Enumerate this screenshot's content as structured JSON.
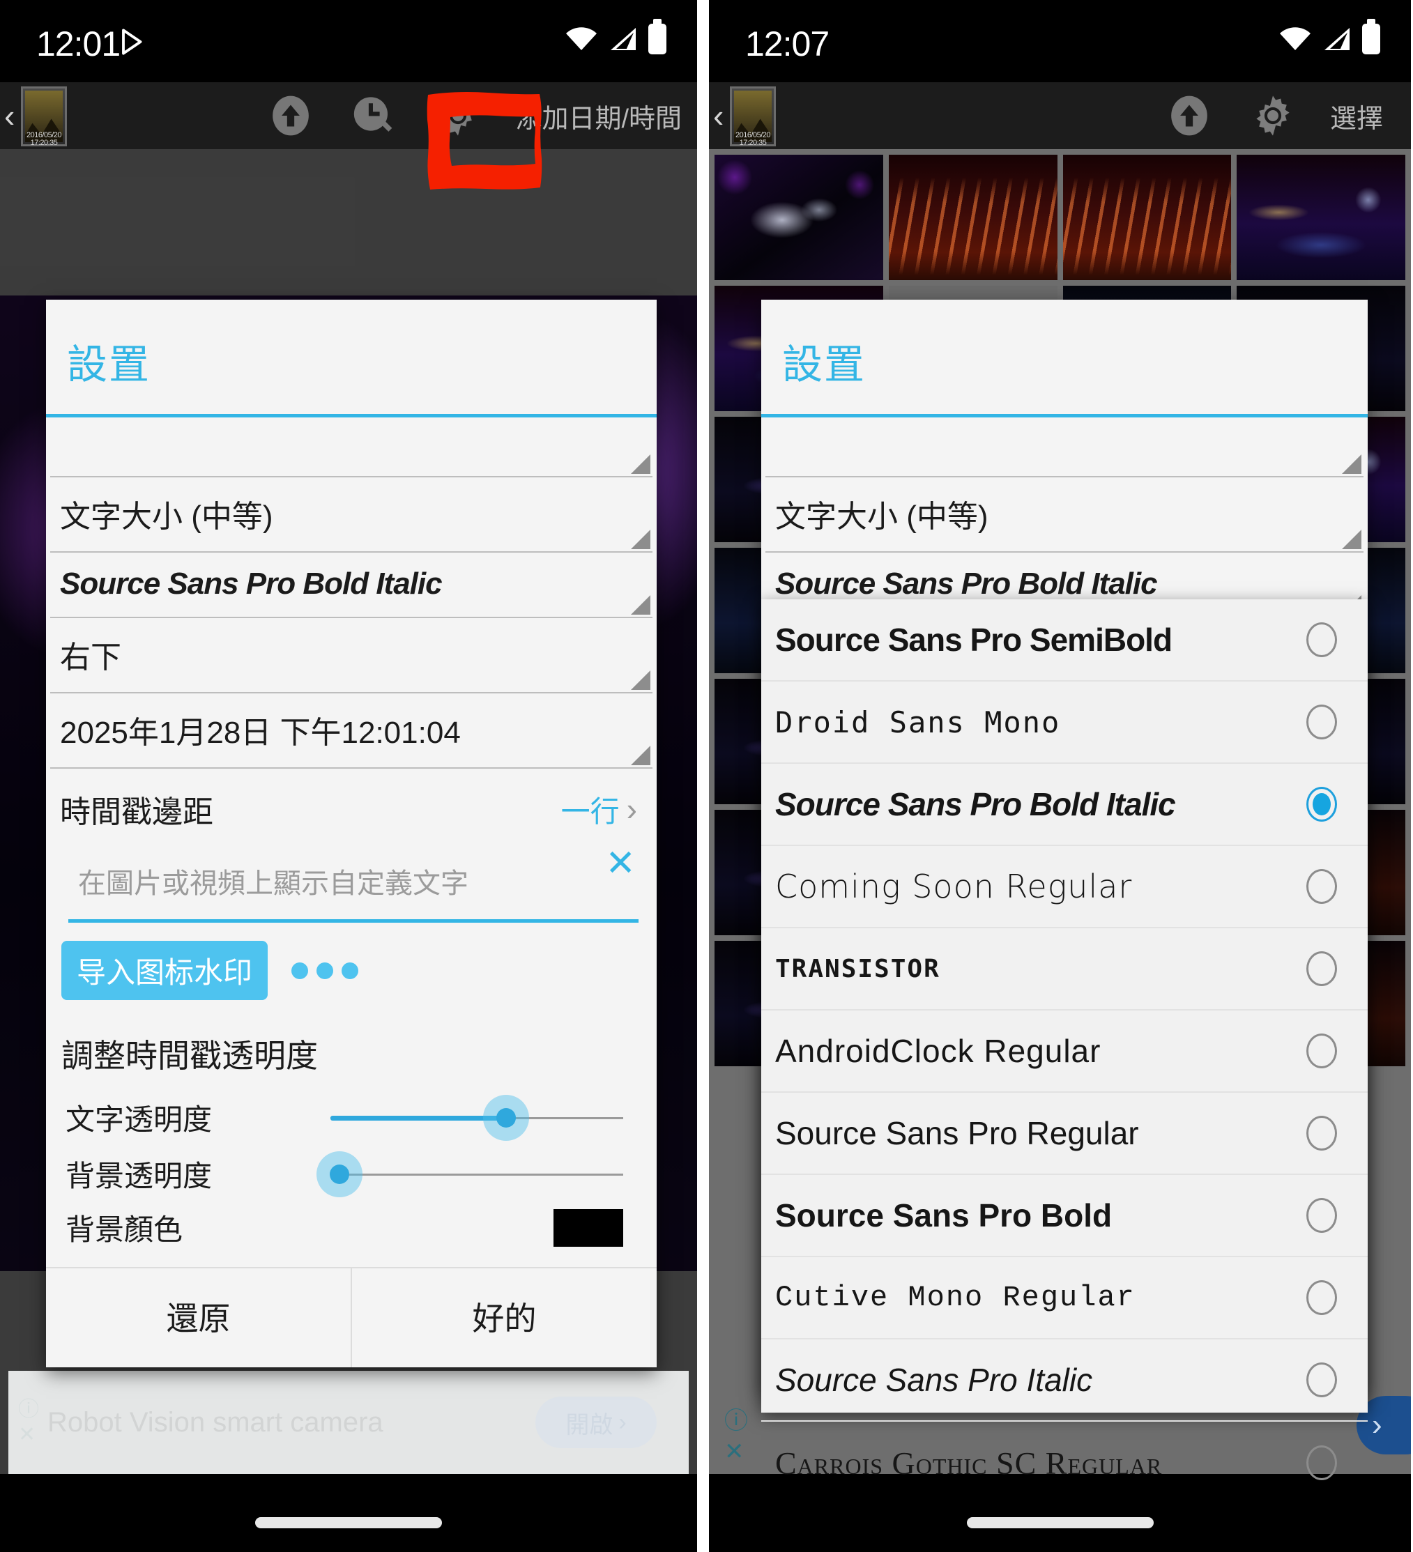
{
  "left_phone": {
    "status": {
      "time": "12:01",
      "icons": [
        "play-store-icon",
        "wifi-icon",
        "signal-icon",
        "battery-icon"
      ]
    },
    "appbar": {
      "back_glyph": "‹",
      "thumb_label_line1": "2016/05/20",
      "thumb_label_line2": "17:20:35",
      "upload_icon": "upload-icon",
      "clock_edit_icon": "clock-edit-icon",
      "gear_icon": "gear-icon",
      "title": "添加日期/時間"
    },
    "dialog": {
      "title": "設置",
      "greybar_value": "",
      "text_size": "文字大小 (中等)",
      "font": "Source Sans Pro Bold Italic",
      "position": "右下",
      "datetime": "2025年1月28日 下午12:01:04",
      "margin_label": "時間戳邊距",
      "margin_value": "一行",
      "custom_text_placeholder": "在圖片或視頻上顯示自定義文字",
      "import_watermark_button": "导入图标水印",
      "more_dots": "•••",
      "opacity_section": "調整時間戳透明度",
      "text_opacity_label": "文字透明度",
      "text_opacity_percent": 60,
      "bg_opacity_label": "背景透明度",
      "bg_opacity_percent": 3,
      "bg_color_label": "背景顏色",
      "bg_color_value": "#000000",
      "restore_button": "還原",
      "ok_button": "好的"
    },
    "ad_banner": {
      "title": "Robot Vision smart camera",
      "cta": "開啟",
      "cta_chevron": "›",
      "info_icon": "info-icon",
      "close_icon": "close-icon"
    },
    "annotation": {
      "type": "red-box",
      "target": "gear-icon",
      "color": "#f52000"
    }
  },
  "right_phone": {
    "status": {
      "time": "12:07",
      "icons": [
        "wifi-icon",
        "signal-icon",
        "battery-icon"
      ]
    },
    "appbar": {
      "back_glyph": "‹",
      "thumb_label_line1": "2016/05/20",
      "thumb_label_line2": "17:20:35",
      "upload_icon": "upload-icon",
      "gear_icon": "gear-icon",
      "select_label": "選擇"
    },
    "dialog": {
      "title": "設置",
      "text_size": "文字大小 (中等)",
      "font": "Source Sans Pro Bold Italic"
    },
    "font_list": [
      {
        "name": "Source Sans Pro SemiBold",
        "style": "f-semibold",
        "selected": false
      },
      {
        "name": "Droid Sans Mono",
        "style": "f-mono",
        "selected": false
      },
      {
        "name": "Source Sans Pro Bold Italic",
        "style": "f-bolditalic",
        "selected": true
      },
      {
        "name": "Coming Soon Regular",
        "style": "f-comic",
        "selected": false
      },
      {
        "name": "TRANSISTOR",
        "style": "f-lcd",
        "selected": false
      },
      {
        "name": "AndroidClock Regular",
        "style": "f-clock",
        "selected": false
      },
      {
        "name": "Source Sans Pro Regular",
        "style": "f-regular",
        "selected": false
      },
      {
        "name": "Source Sans Pro Bold",
        "style": "f-bold",
        "selected": false
      },
      {
        "name": "Cutive Mono Regular",
        "style": "f-cutive",
        "selected": false
      },
      {
        "name": "Source Sans Pro Italic",
        "style": "f-italic",
        "selected": false
      },
      {
        "name": "Carrois Gothic SC Regular",
        "style": "f-smallcaps",
        "selected": false
      }
    ],
    "fab": {
      "chevron": "›",
      "color": "#1c4f8f"
    },
    "corner_icons": {
      "info_icon": "ⓘ",
      "close_icon": "✕"
    },
    "annotation": {
      "type": "red-arrow",
      "target": "font-spinner-row",
      "color": "#f52000"
    }
  },
  "accent_color": "#33b5e5"
}
